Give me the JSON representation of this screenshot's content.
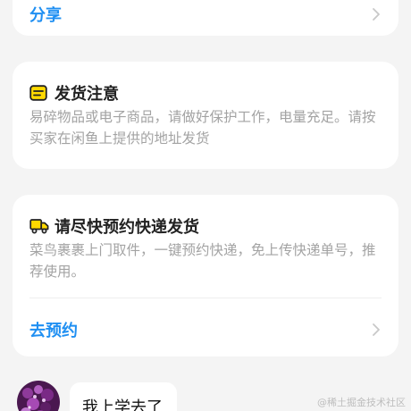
{
  "share_card": {
    "label": "分享"
  },
  "notice_card": {
    "icon": "receipt-icon",
    "title": "发货注意",
    "body": "易碎物品或电子商品，请做好保护工作，电量充足。请按买家在闲鱼上提供的地址发货"
  },
  "express_card": {
    "icon": "delivery-truck-icon",
    "title": "请尽快预约快递发货",
    "body": "菜鸟裹裹上门取件，一键预约快递，免上传快递单号，推荐使用。",
    "action_label": "去预约"
  },
  "chat": {
    "message": "我上学去了"
  },
  "watermark": "@稀土掘金技术社区",
  "colors": {
    "accent": "#1f8ff2",
    "icon_yellow": "#ffd900",
    "muted_text": "#a3a3a3",
    "background": "#f4f4f4"
  }
}
